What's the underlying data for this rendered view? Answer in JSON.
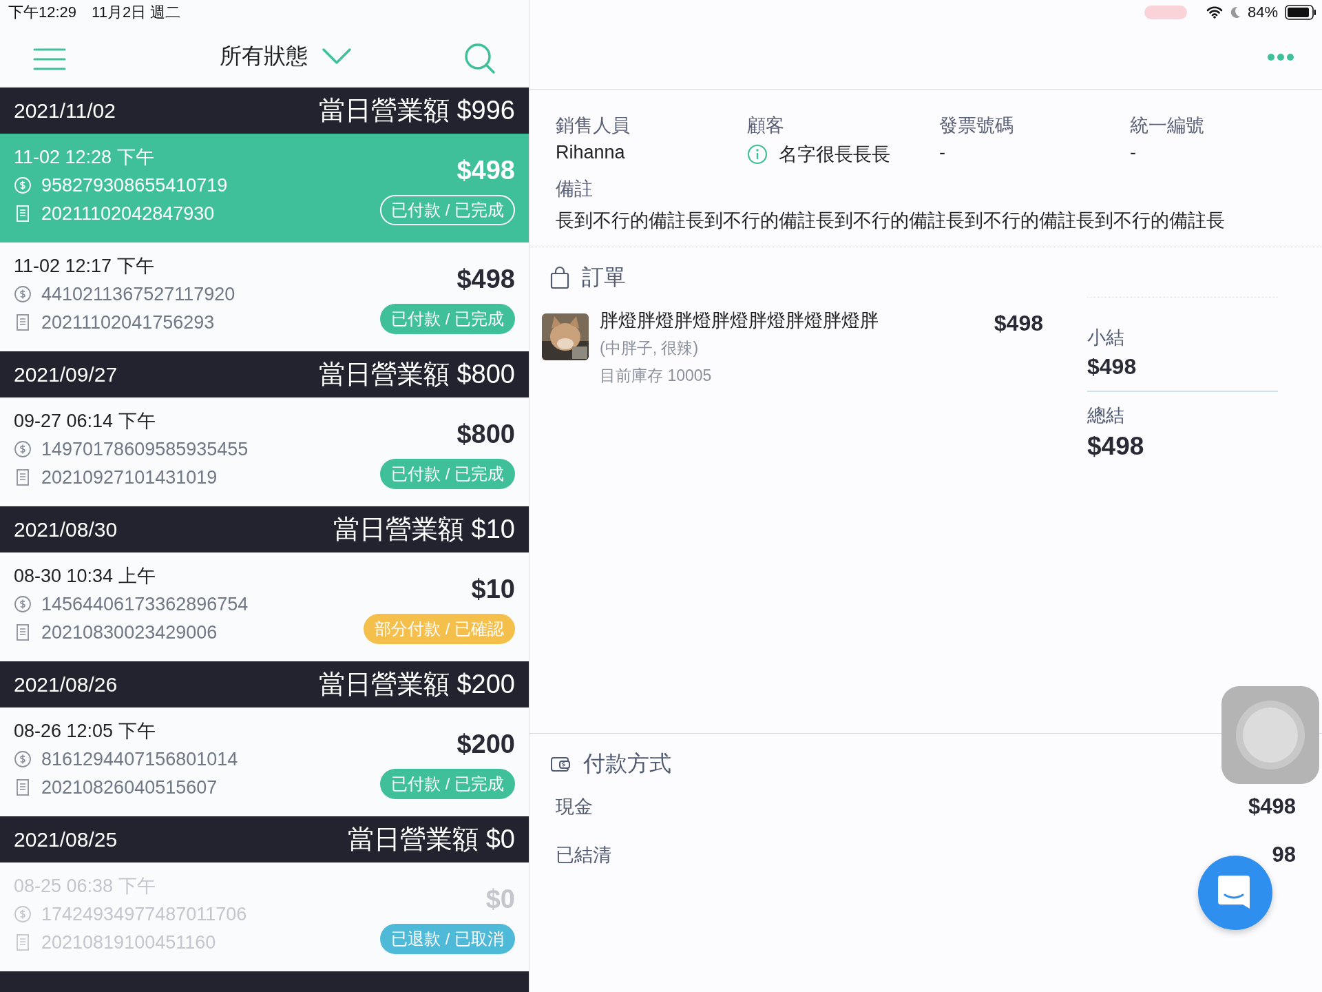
{
  "status_bar": {
    "time": "下午12:29",
    "date": "11月2日 週二",
    "battery": "84%"
  },
  "nav": {
    "filter": "所有狀態"
  },
  "days": [
    {
      "date": "2021/11/02",
      "total": "當日營業額 $996",
      "orders": [
        {
          "time": "11-02 12:28 下午",
          "payment_id": "958279308655410719",
          "invoice": "20211102042847930",
          "amount": "$498",
          "status": "已付款 / 已完成",
          "kind": "paid",
          "selected": true,
          "disabled": false
        },
        {
          "time": "11-02 12:17 下午",
          "payment_id": "4410211367527117920",
          "invoice": "20211102041756293",
          "amount": "$498",
          "status": "已付款 / 已完成",
          "kind": "paid",
          "selected": false,
          "disabled": false
        }
      ]
    },
    {
      "date": "2021/09/27",
      "total": "當日營業額 $800",
      "orders": [
        {
          "time": "09-27 06:14 下午",
          "payment_id": "14970178609585935455",
          "invoice": "20210927101431019",
          "amount": "$800",
          "status": "已付款 / 已完成",
          "kind": "paid",
          "selected": false,
          "disabled": false
        }
      ]
    },
    {
      "date": "2021/08/30",
      "total": "當日營業額 $10",
      "orders": [
        {
          "time": "08-30 10:34 上午",
          "payment_id": "14564406173362896754",
          "invoice": "20210830023429006",
          "amount": "$10",
          "status": "部分付款 / 已確認",
          "kind": "partial",
          "selected": false,
          "disabled": false
        }
      ]
    },
    {
      "date": "2021/08/26",
      "total": "當日營業額 $200",
      "orders": [
        {
          "time": "08-26 12:05 下午",
          "payment_id": "8161294407156801014",
          "invoice": "20210826040515607",
          "amount": "$200",
          "status": "已付款 / 已完成",
          "kind": "paid",
          "selected": false,
          "disabled": false
        }
      ]
    },
    {
      "date": "2021/08/25",
      "total": "當日營業額 $0",
      "orders": [
        {
          "time": "08-25 06:38 下午",
          "payment_id": "17424934977487011706",
          "invoice": "20210819100451160",
          "amount": "$0",
          "status": "已退款 / 已取消",
          "kind": "refunded",
          "selected": false,
          "disabled": true
        }
      ]
    }
  ],
  "more_below": true,
  "detail": {
    "fields": [
      {
        "label": "銷售人員",
        "value": "Rihanna",
        "info_icon": false
      },
      {
        "label": "顧客",
        "value": "名字很長長長",
        "info_icon": true
      },
      {
        "label": "發票號碼",
        "value": "-",
        "info_icon": false
      },
      {
        "label": "統一編號",
        "value": "-",
        "info_icon": false
      }
    ],
    "note": {
      "label": "備註",
      "value": "長到不行的備註長到不行的備註長到不行的備註長到不行的備註長到不行的備註長"
    },
    "order": {
      "title": "訂單",
      "items": [
        {
          "name": "胖燈胖燈胖燈胖燈胖燈胖燈胖燈胖",
          "options": "(中胖子, 很辣)",
          "stock": "目前庫存 10005",
          "price": "$498"
        }
      ],
      "subtotal_label": "小結",
      "subtotal": "$498",
      "total_label": "總結",
      "total": "$498"
    },
    "payment": {
      "title": "付款方式",
      "rows": [
        {
          "label": "現金",
          "value": "$498"
        },
        {
          "label": "已結清",
          "value": "98"
        }
      ]
    }
  }
}
